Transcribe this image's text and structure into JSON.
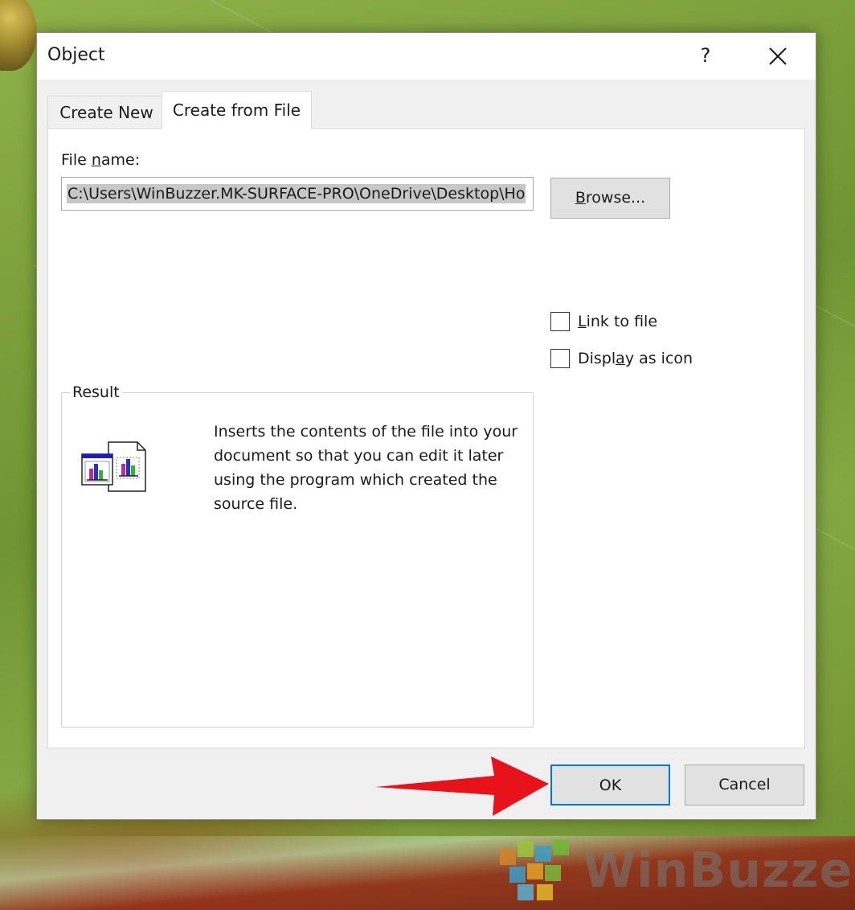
{
  "dialog": {
    "title": "Object",
    "help_label": "?",
    "tabs": [
      {
        "label": "Create New",
        "active": false
      },
      {
        "label": "Create from File",
        "active": true
      }
    ],
    "file_name_label_pre": "File ",
    "file_name_label_accel": "n",
    "file_name_label_post": "ame:",
    "file_name_value": "C:\\Users\\WinBuzzer.MK-SURFACE-PRO\\OneDrive\\Desktop\\Ho",
    "browse": {
      "accel": "B",
      "rest": "rowse..."
    },
    "link_to_file": {
      "accel": "L",
      "rest": "ink to file",
      "checked": false
    },
    "display_as_icon": {
      "pre": "Displ",
      "accel": "a",
      "rest": "y as icon",
      "checked": false
    },
    "result": {
      "legend": "Result",
      "text": "Inserts the contents of the file into your document so that you can edit it later using the program which created the source file."
    },
    "ok_label": "OK",
    "cancel_label": "Cancel"
  },
  "watermark": {
    "text": "WinBuzzer"
  },
  "colors": {
    "focus_border": "#0078d7",
    "arrow": "#e8121b"
  }
}
